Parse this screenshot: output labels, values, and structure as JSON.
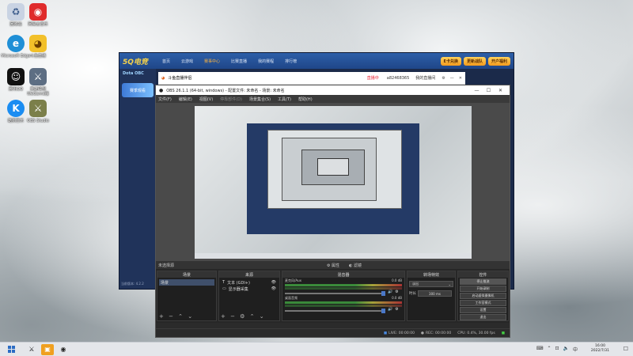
{
  "desktop": {
    "icons": [
      {
        "label": "回收站",
        "glyph": "♻",
        "color": "#c9d3e3"
      },
      {
        "label": "网易云音乐",
        "glyph": "◉",
        "color": "#e02b2b"
      },
      {
        "label": "Microsoft Edge",
        "glyph": "e",
        "color": "#1f8fd6"
      },
      {
        "label": "斗鱼直播",
        "glyph": "◕",
        "color": "#f2c02a"
      },
      {
        "label": "腾讯QQ",
        "glyph": "☺",
        "color": "#111111"
      },
      {
        "label": "英雄联盟WeGame版",
        "glyph": "⚔",
        "color": "#5d6e83"
      },
      {
        "label": "酷狗音乐",
        "glyph": "K",
        "color": "#1b8df2"
      },
      {
        "label": "OBS Studio",
        "glyph": "⚔",
        "color": "#7b7f4a"
      }
    ]
  },
  "launcher": {
    "logo": "5Q电竞",
    "nav": [
      "首页",
      "云游戏",
      "赛事中心",
      "比赛直播",
      "我的赛程",
      "排行榜",
      "我的战队"
    ],
    "active_nav_index": 2,
    "buttons": [
      "E卡兑换",
      "更新战队",
      "开户福利"
    ],
    "side_title": "Dota OBC",
    "banner": "赛季观看",
    "footer": "当前版本: 4.2.2"
  },
  "assist": {
    "title": "斗鱼直播伴侣",
    "live_status": "直播中",
    "user": "a82468365",
    "action": "我的直播间"
  },
  "obs": {
    "title": "OBS 26.1.1 (64-bit, windows) - 配置文件: 未命名 - 场景: 未命名",
    "menu": [
      "文件(F)",
      "编辑(E)",
      "视图(V)",
      "停靠部件(D)",
      "场景集合(S)",
      "工具(T)",
      "帮助(H)"
    ],
    "toolbar": [
      "属性",
      "滤镜"
    ],
    "docks": {
      "scenes": {
        "title": "场景",
        "items": [
          "场景"
        ]
      },
      "sources": {
        "title": "来源",
        "items": [
          "文本 (GDI+)",
          "显示器采集"
        ]
      },
      "mixer": {
        "title": "混音器",
        "channels": [
          {
            "name": "麦克风/Aux",
            "db": "0.0 dB"
          },
          {
            "name": "桌面音频",
            "db": "0.0 dB"
          }
        ]
      },
      "transitions": {
        "title": "转场特效",
        "type": "淡出",
        "duration_label": "时长",
        "duration": "300 ms"
      },
      "controls": {
        "title": "控件",
        "buttons": [
          "停止推流",
          "开始录制",
          "启动虚拟摄像机",
          "工作室模式",
          "设置",
          "退出"
        ]
      }
    },
    "no_source_label": "未选择源",
    "status": {
      "live": "LIVE: 00:00:00",
      "rec": "REC: 00:00:00",
      "cpu": "CPU: 0.4%, 30.00 fps"
    }
  },
  "taskbar": {
    "clock_time": "16:00",
    "clock_date": "2022/7/31",
    "lang": "中"
  }
}
